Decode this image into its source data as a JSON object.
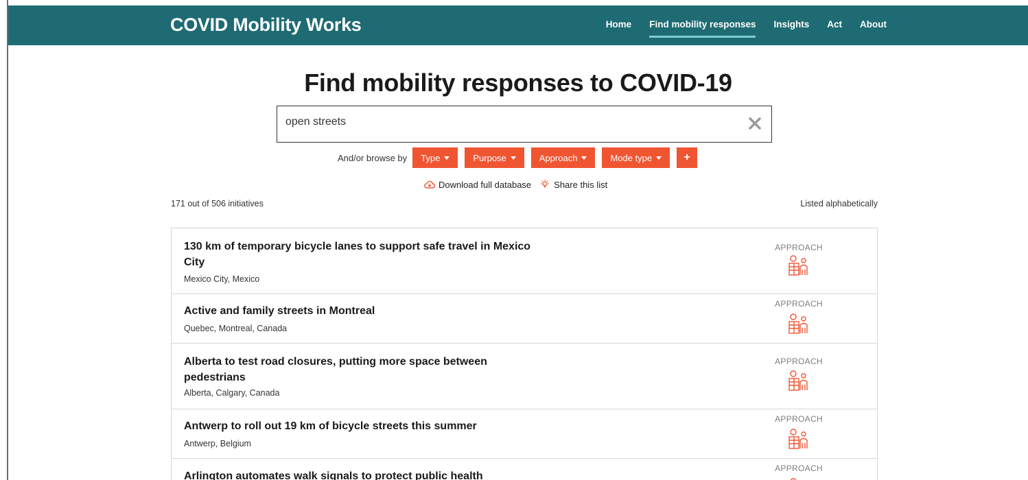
{
  "header": {
    "brand": "COVID Mobility Works",
    "nav": [
      {
        "label": "Home",
        "active": false
      },
      {
        "label": "Find mobility responses",
        "active": true
      },
      {
        "label": "Insights",
        "active": false
      },
      {
        "label": "Act",
        "active": false
      },
      {
        "label": "About",
        "active": false
      }
    ]
  },
  "page_title": "Find mobility responses to COVID-19",
  "search": {
    "value": "open streets",
    "clear_icon": "close-x-icon"
  },
  "browse": {
    "label": "And/or browse by",
    "filters": [
      "Type",
      "Purpose",
      "Approach",
      "Mode type"
    ],
    "add_label": "+"
  },
  "links": {
    "download": "Download full database",
    "share": "Share this list"
  },
  "results": {
    "count_text": "171 out of 506 initiatives",
    "sort_text": "Listed alphabetically",
    "items": [
      {
        "title": "130 km of temporary bicycle lanes to support safe travel in Mexico City",
        "location": "Mexico City, Mexico",
        "tag": "APPROACH"
      },
      {
        "title": "Active and family streets in Montreal",
        "location": "Quebec, Montreal, Canada",
        "tag": "APPROACH"
      },
      {
        "title": "Alberta to test road closures, putting more space between pedestrians",
        "location": "Alberta, Calgary, Canada",
        "tag": "APPROACH"
      },
      {
        "title": "Antwerp to roll out 19 km of bicycle streets this summer",
        "location": "Antwerp, Belgium",
        "tag": "APPROACH"
      },
      {
        "title": "Arlington automates walk signals to protect public health",
        "location": "",
        "tag": "APPROACH"
      }
    ]
  },
  "colors": {
    "navbar": "#1e6b73",
    "accent": "#f05532",
    "nav_underline": "#7ecfd3"
  }
}
